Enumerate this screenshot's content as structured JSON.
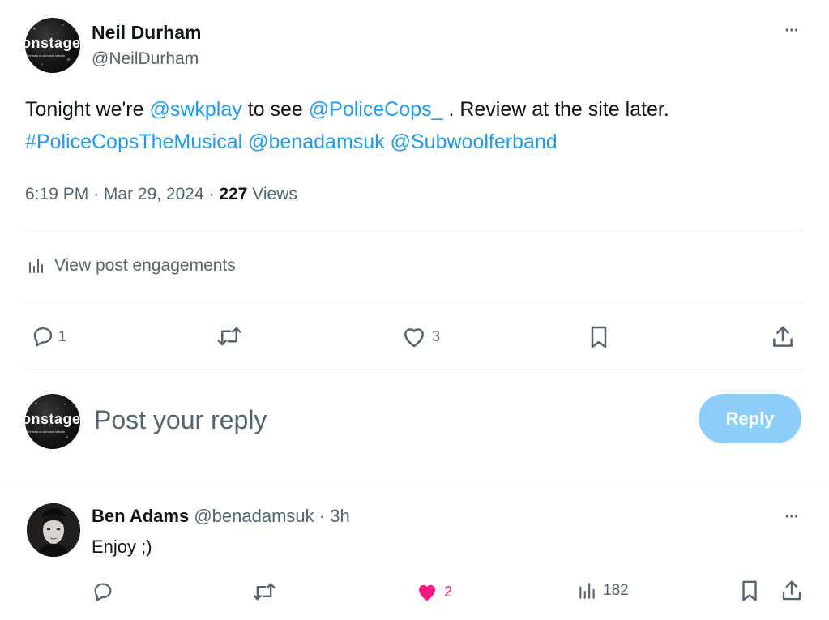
{
  "post": {
    "author_name": "Neil Durham",
    "author_handle": "@NeilDurham",
    "avatar_word": "onstage",
    "avatar_tagline": "the best in-demand tickets",
    "text_parts": {
      "t1": "Tonight we're ",
      "l1": "@swkplay",
      "t2": " to see ",
      "l2": "@PoliceCops_",
      "t3": " . Review at the site later.",
      "l3": "#PoliceCopsTheMusical",
      "t4": " ",
      "l4": "@benadamsuk",
      "t5": " ",
      "l5": "@Subwoolferband"
    },
    "time": "6:19 PM",
    "date": "Mar 29, 2024",
    "separator": "·",
    "views_count": "227",
    "views_label": "Views",
    "engagements_label": "View post engagements",
    "more_label": "···",
    "actions": {
      "reply_count": "1",
      "repost_count": "",
      "like_count": "3"
    }
  },
  "compose": {
    "placeholder": "Post your reply",
    "button_label": "Reply"
  },
  "reply": {
    "author_name": "Ben Adams",
    "author_handle": "@benadamsuk",
    "time_ago": "3h",
    "text": "Enjoy ;)",
    "like_count": "2",
    "views_count": "182",
    "more_label": "···"
  },
  "colors": {
    "accent": "#1d9bf0",
    "reply_button_disabled": "#8ecdf8",
    "like_active": "#f91880",
    "muted": "#536471",
    "text": "#0f1419"
  }
}
